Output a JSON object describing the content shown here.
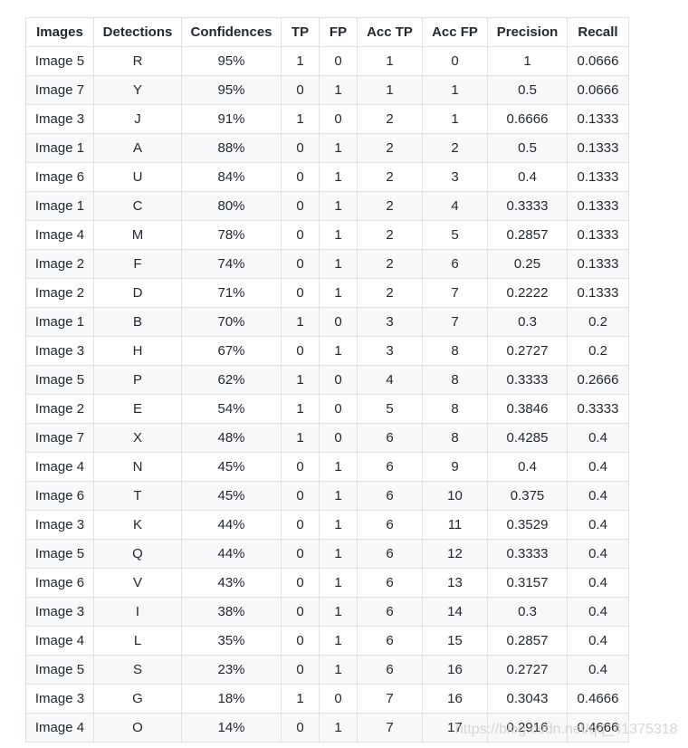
{
  "table": {
    "headers": [
      "Images",
      "Detections",
      "Confidences",
      "TP",
      "FP",
      "Acc TP",
      "Acc FP",
      "Precision",
      "Recall"
    ],
    "rows": [
      [
        "Image 5",
        "R",
        "95%",
        "1",
        "0",
        "1",
        "0",
        "1",
        "0.0666"
      ],
      [
        "Image 7",
        "Y",
        "95%",
        "0",
        "1",
        "1",
        "1",
        "0.5",
        "0.0666"
      ],
      [
        "Image 3",
        "J",
        "91%",
        "1",
        "0",
        "2",
        "1",
        "0.6666",
        "0.1333"
      ],
      [
        "Image 1",
        "A",
        "88%",
        "0",
        "1",
        "2",
        "2",
        "0.5",
        "0.1333"
      ],
      [
        "Image 6",
        "U",
        "84%",
        "0",
        "1",
        "2",
        "3",
        "0.4",
        "0.1333"
      ],
      [
        "Image 1",
        "C",
        "80%",
        "0",
        "1",
        "2",
        "4",
        "0.3333",
        "0.1333"
      ],
      [
        "Image 4",
        "M",
        "78%",
        "0",
        "1",
        "2",
        "5",
        "0.2857",
        "0.1333"
      ],
      [
        "Image 2",
        "F",
        "74%",
        "0",
        "1",
        "2",
        "6",
        "0.25",
        "0.1333"
      ],
      [
        "Image 2",
        "D",
        "71%",
        "0",
        "1",
        "2",
        "7",
        "0.2222",
        "0.1333"
      ],
      [
        "Image 1",
        "B",
        "70%",
        "1",
        "0",
        "3",
        "7",
        "0.3",
        "0.2"
      ],
      [
        "Image 3",
        "H",
        "67%",
        "0",
        "1",
        "3",
        "8",
        "0.2727",
        "0.2"
      ],
      [
        "Image 5",
        "P",
        "62%",
        "1",
        "0",
        "4",
        "8",
        "0.3333",
        "0.2666"
      ],
      [
        "Image 2",
        "E",
        "54%",
        "1",
        "0",
        "5",
        "8",
        "0.3846",
        "0.3333"
      ],
      [
        "Image 7",
        "X",
        "48%",
        "1",
        "0",
        "6",
        "8",
        "0.4285",
        "0.4"
      ],
      [
        "Image 4",
        "N",
        "45%",
        "0",
        "1",
        "6",
        "9",
        "0.4",
        "0.4"
      ],
      [
        "Image 6",
        "T",
        "45%",
        "0",
        "1",
        "6",
        "10",
        "0.375",
        "0.4"
      ],
      [
        "Image 3",
        "K",
        "44%",
        "0",
        "1",
        "6",
        "11",
        "0.3529",
        "0.4"
      ],
      [
        "Image 5",
        "Q",
        "44%",
        "0",
        "1",
        "6",
        "12",
        "0.3333",
        "0.4"
      ],
      [
        "Image 6",
        "V",
        "43%",
        "0",
        "1",
        "6",
        "13",
        "0.3157",
        "0.4"
      ],
      [
        "Image 3",
        "I",
        "38%",
        "0",
        "1",
        "6",
        "14",
        "0.3",
        "0.4"
      ],
      [
        "Image 4",
        "L",
        "35%",
        "0",
        "1",
        "6",
        "15",
        "0.2857",
        "0.4"
      ],
      [
        "Image 5",
        "S",
        "23%",
        "0",
        "1",
        "6",
        "16",
        "0.2727",
        "0.4"
      ],
      [
        "Image 3",
        "G",
        "18%",
        "1",
        "0",
        "7",
        "16",
        "0.3043",
        "0.4666"
      ],
      [
        "Image 4",
        "O",
        "14%",
        "0",
        "1",
        "7",
        "17",
        "0.2916",
        "0.4666"
      ]
    ]
  },
  "watermark": "https://blog.csdn.net/qq_41375318"
}
